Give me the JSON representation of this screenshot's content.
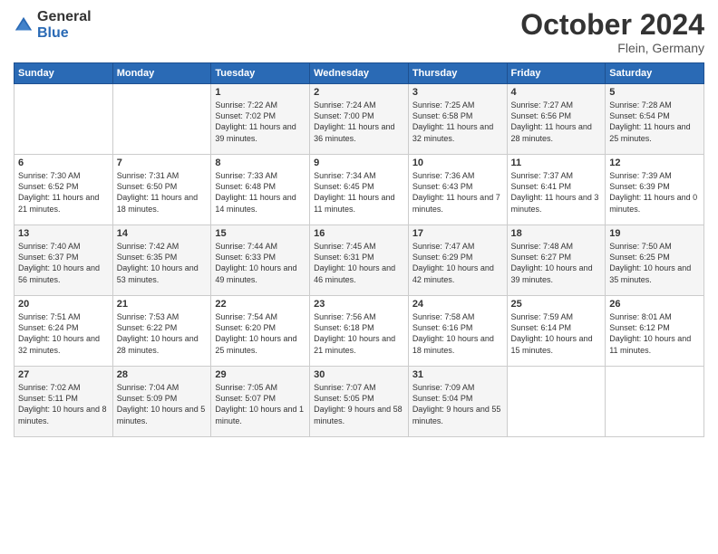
{
  "logo": {
    "general": "General",
    "blue": "Blue"
  },
  "title": "October 2024",
  "location": "Flein, Germany",
  "days_of_week": [
    "Sunday",
    "Monday",
    "Tuesday",
    "Wednesday",
    "Thursday",
    "Friday",
    "Saturday"
  ],
  "weeks": [
    [
      {
        "day": "",
        "content": ""
      },
      {
        "day": "",
        "content": ""
      },
      {
        "day": "1",
        "content": "Sunrise: 7:22 AM\nSunset: 7:02 PM\nDaylight: 11 hours\nand 39 minutes."
      },
      {
        "day": "2",
        "content": "Sunrise: 7:24 AM\nSunset: 7:00 PM\nDaylight: 11 hours\nand 36 minutes."
      },
      {
        "day": "3",
        "content": "Sunrise: 7:25 AM\nSunset: 6:58 PM\nDaylight: 11 hours\nand 32 minutes."
      },
      {
        "day": "4",
        "content": "Sunrise: 7:27 AM\nSunset: 6:56 PM\nDaylight: 11 hours\nand 28 minutes."
      },
      {
        "day": "5",
        "content": "Sunrise: 7:28 AM\nSunset: 6:54 PM\nDaylight: 11 hours\nand 25 minutes."
      }
    ],
    [
      {
        "day": "6",
        "content": "Sunrise: 7:30 AM\nSunset: 6:52 PM\nDaylight: 11 hours\nand 21 minutes."
      },
      {
        "day": "7",
        "content": "Sunrise: 7:31 AM\nSunset: 6:50 PM\nDaylight: 11 hours\nand 18 minutes."
      },
      {
        "day": "8",
        "content": "Sunrise: 7:33 AM\nSunset: 6:48 PM\nDaylight: 11 hours\nand 14 minutes."
      },
      {
        "day": "9",
        "content": "Sunrise: 7:34 AM\nSunset: 6:45 PM\nDaylight: 11 hours\nand 11 minutes."
      },
      {
        "day": "10",
        "content": "Sunrise: 7:36 AM\nSunset: 6:43 PM\nDaylight: 11 hours\nand 7 minutes."
      },
      {
        "day": "11",
        "content": "Sunrise: 7:37 AM\nSunset: 6:41 PM\nDaylight: 11 hours\nand 3 minutes."
      },
      {
        "day": "12",
        "content": "Sunrise: 7:39 AM\nSunset: 6:39 PM\nDaylight: 11 hours\nand 0 minutes."
      }
    ],
    [
      {
        "day": "13",
        "content": "Sunrise: 7:40 AM\nSunset: 6:37 PM\nDaylight: 10 hours\nand 56 minutes."
      },
      {
        "day": "14",
        "content": "Sunrise: 7:42 AM\nSunset: 6:35 PM\nDaylight: 10 hours\nand 53 minutes."
      },
      {
        "day": "15",
        "content": "Sunrise: 7:44 AM\nSunset: 6:33 PM\nDaylight: 10 hours\nand 49 minutes."
      },
      {
        "day": "16",
        "content": "Sunrise: 7:45 AM\nSunset: 6:31 PM\nDaylight: 10 hours\nand 46 minutes."
      },
      {
        "day": "17",
        "content": "Sunrise: 7:47 AM\nSunset: 6:29 PM\nDaylight: 10 hours\nand 42 minutes."
      },
      {
        "day": "18",
        "content": "Sunrise: 7:48 AM\nSunset: 6:27 PM\nDaylight: 10 hours\nand 39 minutes."
      },
      {
        "day": "19",
        "content": "Sunrise: 7:50 AM\nSunset: 6:25 PM\nDaylight: 10 hours\nand 35 minutes."
      }
    ],
    [
      {
        "day": "20",
        "content": "Sunrise: 7:51 AM\nSunset: 6:24 PM\nDaylight: 10 hours\nand 32 minutes."
      },
      {
        "day": "21",
        "content": "Sunrise: 7:53 AM\nSunset: 6:22 PM\nDaylight: 10 hours\nand 28 minutes."
      },
      {
        "day": "22",
        "content": "Sunrise: 7:54 AM\nSunset: 6:20 PM\nDaylight: 10 hours\nand 25 minutes."
      },
      {
        "day": "23",
        "content": "Sunrise: 7:56 AM\nSunset: 6:18 PM\nDaylight: 10 hours\nand 21 minutes."
      },
      {
        "day": "24",
        "content": "Sunrise: 7:58 AM\nSunset: 6:16 PM\nDaylight: 10 hours\nand 18 minutes."
      },
      {
        "day": "25",
        "content": "Sunrise: 7:59 AM\nSunset: 6:14 PM\nDaylight: 10 hours\nand 15 minutes."
      },
      {
        "day": "26",
        "content": "Sunrise: 8:01 AM\nSunset: 6:12 PM\nDaylight: 10 hours\nand 11 minutes."
      }
    ],
    [
      {
        "day": "27",
        "content": "Sunrise: 7:02 AM\nSunset: 5:11 PM\nDaylight: 10 hours\nand 8 minutes."
      },
      {
        "day": "28",
        "content": "Sunrise: 7:04 AM\nSunset: 5:09 PM\nDaylight: 10 hours\nand 5 minutes."
      },
      {
        "day": "29",
        "content": "Sunrise: 7:05 AM\nSunset: 5:07 PM\nDaylight: 10 hours\nand 1 minute."
      },
      {
        "day": "30",
        "content": "Sunrise: 7:07 AM\nSunset: 5:05 PM\nDaylight: 9 hours\nand 58 minutes."
      },
      {
        "day": "31",
        "content": "Sunrise: 7:09 AM\nSunset: 5:04 PM\nDaylight: 9 hours\nand 55 minutes."
      },
      {
        "day": "",
        "content": ""
      },
      {
        "day": "",
        "content": ""
      }
    ]
  ]
}
